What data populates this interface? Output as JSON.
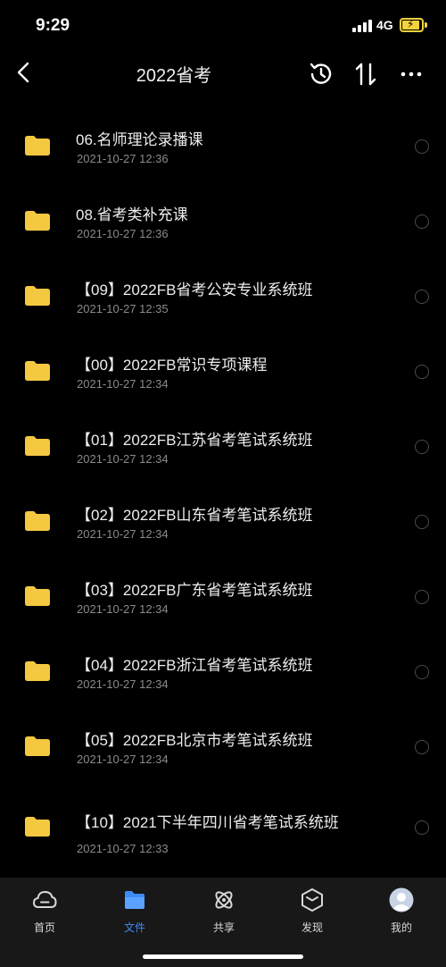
{
  "status_bar": {
    "time": "9:29",
    "network": "4G"
  },
  "nav": {
    "title": "2022省考"
  },
  "files": [
    {
      "name": "06.名师理论录播课",
      "date": "2021-10-27 12:36"
    },
    {
      "name": "08.省考类补充课",
      "date": "2021-10-27 12:36"
    },
    {
      "name": "【09】2022FB省考公安专业系统班",
      "date": "2021-10-27 12:35"
    },
    {
      "name": "【00】2022FB常识专项课程",
      "date": "2021-10-27 12:34"
    },
    {
      "name": "【01】2022FB江苏省考笔试系统班",
      "date": "2021-10-27 12:34"
    },
    {
      "name": "【02】2022FB山东省考笔试系统班",
      "date": "2021-10-27 12:34"
    },
    {
      "name": "【03】2022FB广东省考笔试系统班",
      "date": "2021-10-27 12:34"
    },
    {
      "name": "【04】2022FB浙江省考笔试系统班",
      "date": "2021-10-27 12:34"
    },
    {
      "name": "【05】2022FB北京市考笔试系统班",
      "date": "2021-10-27 12:34"
    },
    {
      "name": "【10】2021下半年四川省考笔试系统班",
      "date": "2021-10-27 12:33"
    }
  ],
  "tabs": [
    {
      "label": "首页",
      "icon": "cloud-icon"
    },
    {
      "label": "文件",
      "icon": "folder-icon"
    },
    {
      "label": "共享",
      "icon": "share-icon"
    },
    {
      "label": "发现",
      "icon": "discover-icon"
    },
    {
      "label": "我的",
      "icon": "avatar-icon"
    }
  ],
  "colors": {
    "folder": "#f5c842",
    "accent": "#3d8bf5",
    "battery": "#f5d33c"
  }
}
